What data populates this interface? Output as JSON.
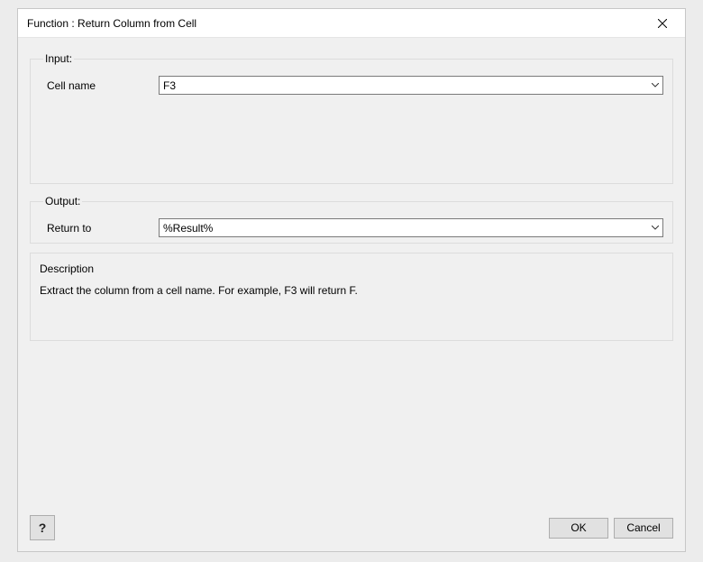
{
  "title": "Function : Return Column from Cell",
  "input": {
    "legend": "Input:",
    "cell_name_label": "Cell name",
    "cell_name_value": "F3"
  },
  "output": {
    "legend": "Output:",
    "return_to_label": "Return to",
    "return_to_value": "%Result%"
  },
  "description": {
    "legend": "Description",
    "text": "Extract the column from a cell name. For example, F3 will return F."
  },
  "buttons": {
    "help": "?",
    "ok": "OK",
    "cancel": "Cancel"
  }
}
